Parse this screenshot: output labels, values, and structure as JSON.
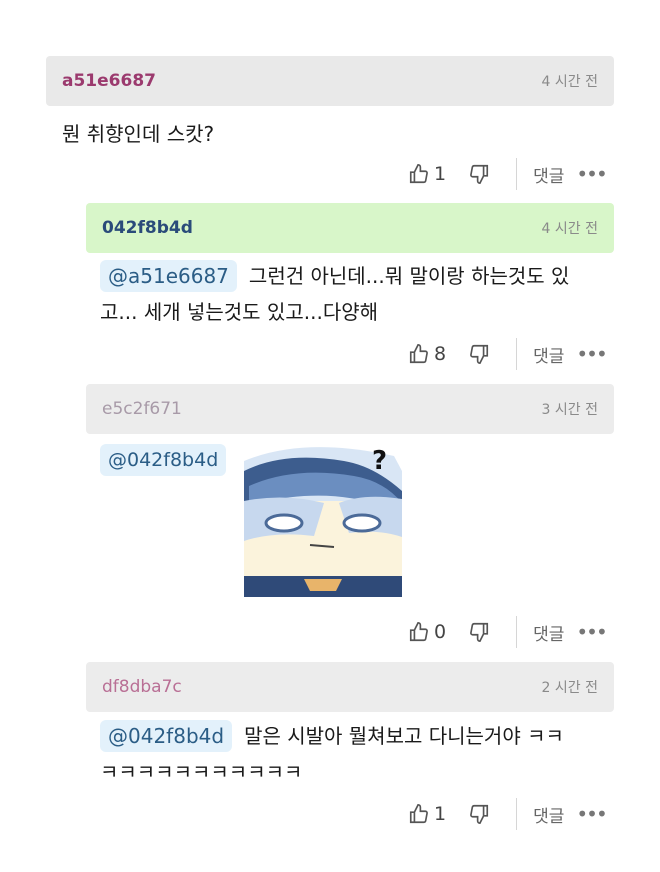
{
  "comments": [
    {
      "username": "a51e6687",
      "time": "4 시간 전",
      "text": "뭔 취향인데 스캇?",
      "likes": "1",
      "reply_label": "댓글",
      "more": "•••",
      "header_color": "#e9e9e9",
      "name_color": "#9b3a6e"
    },
    {
      "username": "042f8b4d",
      "time": "4 시간 전",
      "mention": "@a51e6687",
      "text": "그런건 아닌데...뭐 말이랑 하는것도 있",
      "text2": "고... 세개 넣는것도 있고...다양해",
      "likes": "8",
      "reply_label": "댓글",
      "more": "•••",
      "header_color": "#d8f6c9",
      "name_color": "#2a4b7a"
    },
    {
      "username": "e5c2f671",
      "time": "3 시간 전",
      "mention": "@042f8b4d",
      "likes": "0",
      "reply_label": "댓글",
      "more": "•••",
      "header_color": "#ececec",
      "name_color": "#a89aa8",
      "sticker_mark": "?"
    },
    {
      "username": "df8dba7c",
      "time": "2 시간 전",
      "mention": "@042f8b4d",
      "text": "말은 시발아 뭘쳐보고 다니는거야 ㅋㅋ",
      "text2": "ㅋㅋㅋㅋㅋㅋㅋㅋㅋㅋㅋ",
      "likes": "1",
      "reply_label": "댓글",
      "more": "•••",
      "header_color": "#ececec",
      "name_color": "#b96f95"
    }
  ]
}
